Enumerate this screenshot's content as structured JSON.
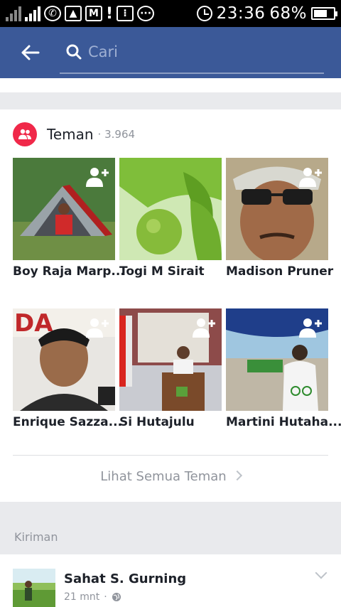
{
  "status_bar": {
    "time": "23:36",
    "battery": "68%",
    "battery_level": 0.68
  },
  "header": {
    "search_placeholder": "Cari",
    "back_icon": "arrow-left-icon",
    "search_icon": "search-icon"
  },
  "friends": {
    "title": "Teman",
    "count": "· 3.964",
    "tiles": [
      {
        "name": "Boy Raja Marp..."
      },
      {
        "name": "Togi M Sirait"
      },
      {
        "name": "Madison Pruner"
      },
      {
        "name": "Enrique Sazza..."
      },
      {
        "name": "Si Hutajulu"
      },
      {
        "name": "Martini Hutaha..."
      }
    ],
    "see_all": "Lihat Semua Teman"
  },
  "posts": {
    "label": "Kiriman",
    "first": {
      "author": "Sahat S. Gurning",
      "time": "21 mnt",
      "separator": "·"
    }
  },
  "colors": {
    "header_bg": "#3b5998",
    "friends_badge": "#f02849"
  }
}
